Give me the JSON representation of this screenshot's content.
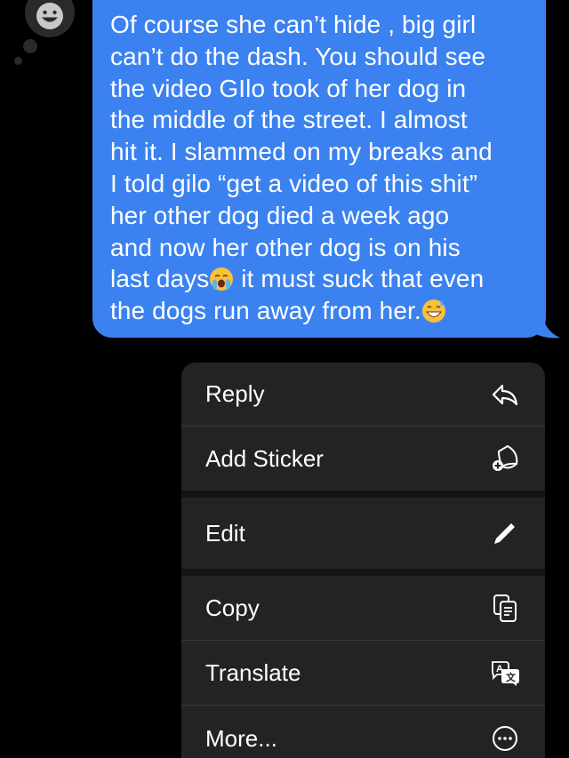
{
  "message": {
    "lines": [
      "Of course she can’t hide , big girl",
      "can’t do the dash. You should see",
      "the video GIlo took of her dog in",
      "the middle of the street. I almost",
      "hit it. I slammed on my breaks and",
      "I told gilo “get a video of this shit”",
      "her other dog died a week ago",
      "and now her other dog is on his",
      "last days",
      " it must suck that even",
      "the dogs run away from her."
    ],
    "emoji_1": "crying-face",
    "emoji_2": "grinning-sweat-face",
    "bubble_color": "#3b82f0"
  },
  "tapback": {
    "icon": "smiley-face-icon"
  },
  "menu": {
    "items": [
      {
        "label": "Reply",
        "icon": "reply-icon"
      },
      {
        "label": "Add Sticker",
        "icon": "sticker-icon"
      },
      {
        "label": "Edit",
        "icon": "pencil-icon"
      },
      {
        "label": "Copy",
        "icon": "copy-icon"
      },
      {
        "label": "Translate",
        "icon": "translate-icon"
      },
      {
        "label": "More...",
        "icon": "more-icon"
      }
    ]
  }
}
